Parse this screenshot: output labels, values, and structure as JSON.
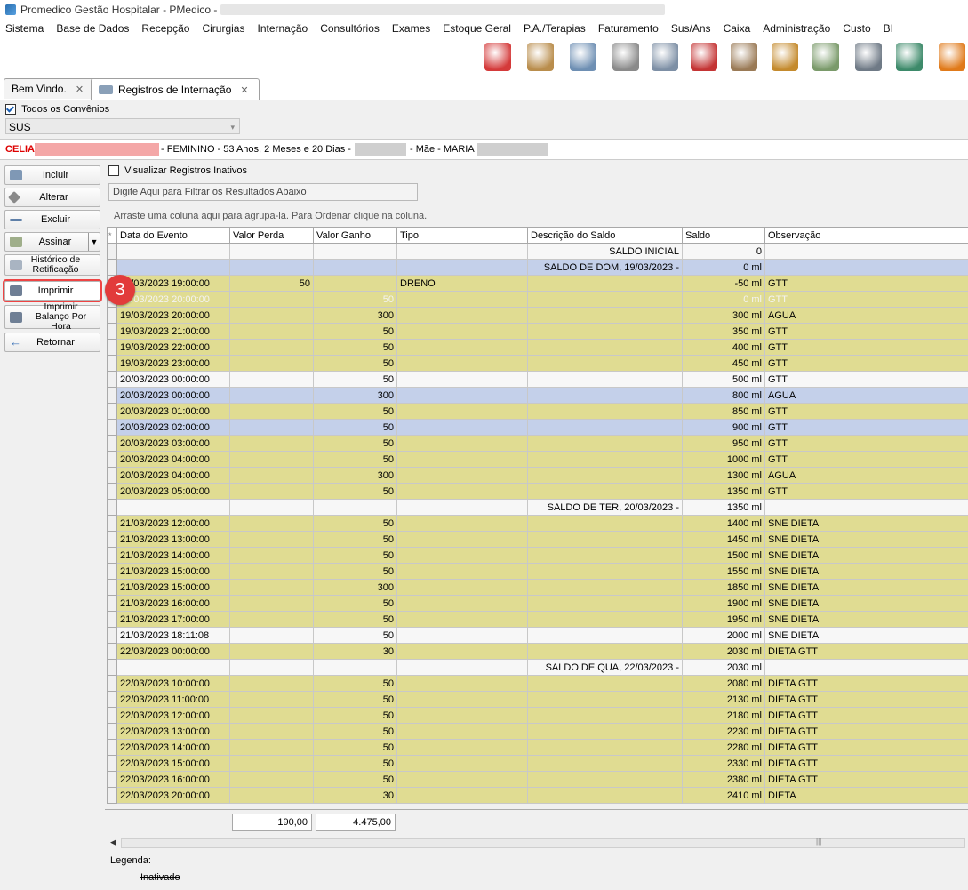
{
  "window": {
    "title": "Promedico Gestão Hospitalar - PMedico -"
  },
  "menu": [
    "Sistema",
    "Base de Dados",
    "Recepção",
    "Cirurgias",
    "Internação",
    "Consultórios",
    "Exames",
    "Estoque Geral",
    "P.A./Terapias",
    "Faturamento",
    "Sus/Ans",
    "Caixa",
    "Administração",
    "Custo",
    "BI"
  ],
  "toolbar_icons": [
    "users-refresh-icon",
    "patients-icon",
    "doctor-icon",
    "document-sign-icon",
    "pharmacy-truck-icon",
    "ambulance-icon",
    "logistics-icon",
    "stock-up-icon",
    "stock-down-icon",
    "safe-icon",
    "cash-register-icon",
    "phone-icon"
  ],
  "tabs": [
    {
      "label": "Bem Vindo."
    },
    {
      "label": "Registros de Internação"
    }
  ],
  "convenios": {
    "all_label": "Todos os Convênios",
    "selected": "SUS"
  },
  "patient": {
    "name": "CELIA",
    "info": "- FEMININO - 53 Anos, 2 Meses e 20 Dias -",
    "mother": "- Mãe - MARIA"
  },
  "actions": {
    "incluir": "Incluir",
    "alterar": "Alterar",
    "excluir": "Excluir",
    "assinar": "Assinar",
    "historico": "Histórico de Retificação",
    "imprimir": "Imprimir",
    "imprimir_balanco": "Imprimir Balanço Por Hora",
    "retornar": "Retornar"
  },
  "step_badge": "3",
  "grid": {
    "show_inactive": "Visualizar Registros Inativos",
    "filter_placeholder": "Digite Aqui para Filtrar os Resultados Abaixo",
    "group_hint": "Arraste uma coluna aqui para agrupa-la. Para Ordenar clique na coluna.",
    "columns": [
      "Data do Evento",
      "Valor Perda",
      "Valor Ganho",
      "Tipo",
      "Descrição do Saldo",
      "Saldo",
      "Observação"
    ],
    "rows": [
      {
        "s": "w",
        "c": [
          "",
          "",
          "",
          "",
          "SALDO INICIAL",
          "0",
          ""
        ]
      },
      {
        "s": "b",
        "c": [
          "",
          "",
          "",
          "",
          "SALDO DE DOM, 19/03/2023 -",
          "0 ml",
          ""
        ]
      },
      {
        "s": "y",
        "c": [
          "19/03/2023 19:00:00",
          "50",
          "",
          "DRENO",
          "",
          "-50 ml",
          "GTT"
        ]
      },
      {
        "s": "yf",
        "c": [
          "19/03/2023 20:00:00",
          "",
          "50",
          "",
          "",
          "0 ml",
          "GTT"
        ]
      },
      {
        "s": "y",
        "c": [
          "19/03/2023 20:00:00",
          "",
          "300",
          "",
          "",
          "300 ml",
          "AGUA"
        ]
      },
      {
        "s": "y",
        "c": [
          "19/03/2023 21:00:00",
          "",
          "50",
          "",
          "",
          "350 ml",
          "GTT"
        ]
      },
      {
        "s": "y",
        "c": [
          "19/03/2023 22:00:00",
          "",
          "50",
          "",
          "",
          "400 ml",
          "GTT"
        ]
      },
      {
        "s": "y",
        "c": [
          "19/03/2023 23:00:00",
          "",
          "50",
          "",
          "",
          "450 ml",
          "GTT"
        ]
      },
      {
        "s": "w",
        "c": [
          "20/03/2023 00:00:00",
          "",
          "50",
          "",
          "",
          "500 ml",
          "GTT"
        ]
      },
      {
        "s": "b",
        "c": [
          "20/03/2023 00:00:00",
          "",
          "300",
          "",
          "",
          "800 ml",
          "AGUA"
        ]
      },
      {
        "s": "y",
        "c": [
          "20/03/2023 01:00:00",
          "",
          "50",
          "",
          "",
          "850 ml",
          "GTT"
        ]
      },
      {
        "s": "b",
        "c": [
          "20/03/2023 02:00:00",
          "",
          "50",
          "",
          "",
          "900 ml",
          "GTT"
        ]
      },
      {
        "s": "y",
        "c": [
          "20/03/2023 03:00:00",
          "",
          "50",
          "",
          "",
          "950 ml",
          "GTT"
        ]
      },
      {
        "s": "y",
        "c": [
          "20/03/2023 04:00:00",
          "",
          "50",
          "",
          "",
          "1000 ml",
          "GTT"
        ]
      },
      {
        "s": "y",
        "c": [
          "20/03/2023 04:00:00",
          "",
          "300",
          "",
          "",
          "1300 ml",
          "AGUA"
        ]
      },
      {
        "s": "y",
        "c": [
          "20/03/2023 05:00:00",
          "",
          "50",
          "",
          "",
          "1350 ml",
          "GTT"
        ]
      },
      {
        "s": "w",
        "c": [
          "",
          "",
          "",
          "",
          "SALDO DE TER, 20/03/2023 -",
          "1350 ml",
          ""
        ]
      },
      {
        "s": "y",
        "c": [
          "21/03/2023 12:00:00",
          "",
          "50",
          "",
          "",
          "1400 ml",
          "SNE DIETA"
        ]
      },
      {
        "s": "y",
        "c": [
          "21/03/2023 13:00:00",
          "",
          "50",
          "",
          "",
          "1450 ml",
          "SNE DIETA"
        ]
      },
      {
        "s": "y",
        "c": [
          "21/03/2023 14:00:00",
          "",
          "50",
          "",
          "",
          "1500 ml",
          "SNE DIETA"
        ]
      },
      {
        "s": "y",
        "c": [
          "21/03/2023 15:00:00",
          "",
          "50",
          "",
          "",
          "1550 ml",
          "SNE DIETA"
        ]
      },
      {
        "s": "y",
        "c": [
          "21/03/2023 15:00:00",
          "",
          "300",
          "",
          "",
          "1850 ml",
          "SNE DIETA"
        ]
      },
      {
        "s": "y",
        "c": [
          "21/03/2023 16:00:00",
          "",
          "50",
          "",
          "",
          "1900 ml",
          "SNE DIETA"
        ]
      },
      {
        "s": "y",
        "c": [
          "21/03/2023 17:00:00",
          "",
          "50",
          "",
          "",
          "1950 ml",
          "SNE DIETA"
        ]
      },
      {
        "s": "w",
        "c": [
          "21/03/2023 18:11:08",
          "",
          "50",
          "",
          "",
          "2000 ml",
          "SNE DIETA"
        ]
      },
      {
        "s": "y",
        "c": [
          "22/03/2023 00:00:00",
          "",
          "30",
          "",
          "",
          "2030 ml",
          "DIETA GTT"
        ]
      },
      {
        "s": "w",
        "c": [
          "",
          "",
          "",
          "",
          "SALDO DE QUA, 22/03/2023 -",
          "2030 ml",
          ""
        ]
      },
      {
        "s": "y",
        "c": [
          "22/03/2023 10:00:00",
          "",
          "50",
          "",
          "",
          "2080 ml",
          "DIETA GTT"
        ]
      },
      {
        "s": "y",
        "c": [
          "22/03/2023 11:00:00",
          "",
          "50",
          "",
          "",
          "2130 ml",
          "DIETA GTT"
        ]
      },
      {
        "s": "y",
        "c": [
          "22/03/2023 12:00:00",
          "",
          "50",
          "",
          "",
          "2180 ml",
          "DIETA GTT"
        ]
      },
      {
        "s": "y",
        "c": [
          "22/03/2023 13:00:00",
          "",
          "50",
          "",
          "",
          "2230 ml",
          "DIETA GTT"
        ]
      },
      {
        "s": "y",
        "c": [
          "22/03/2023 14:00:00",
          "",
          "50",
          "",
          "",
          "2280 ml",
          "DIETA GTT"
        ]
      },
      {
        "s": "y",
        "c": [
          "22/03/2023 15:00:00",
          "",
          "50",
          "",
          "",
          "2330 ml",
          "DIETA GTT"
        ]
      },
      {
        "s": "y",
        "c": [
          "22/03/2023 16:00:00",
          "",
          "50",
          "",
          "",
          "2380 ml",
          "DIETA GTT"
        ]
      },
      {
        "s": "y",
        "c": [
          "22/03/2023 20:00:00",
          "",
          "30",
          "",
          "",
          "2410 ml",
          "DIETA"
        ]
      }
    ],
    "totals": {
      "perda": "190,00",
      "ganho": "4.475,00"
    }
  },
  "legend": {
    "label": "Legenda:",
    "inactive": "Inativado"
  }
}
